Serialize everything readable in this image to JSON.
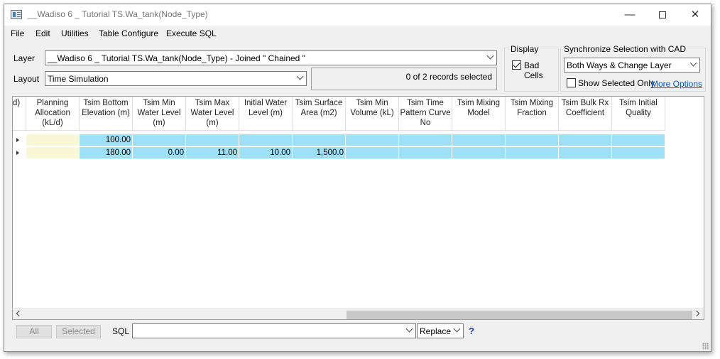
{
  "window": {
    "title": "__Wadiso 6 _ Tutorial TS.Wa_tank(Node_Type)"
  },
  "menu": [
    "File",
    "Edit",
    "Utilities",
    "Table Configure",
    "Execute SQL"
  ],
  "layer": {
    "label": "Layer",
    "value": "__Wadiso 6 _ Tutorial TS.Wa_tank(Node_Type) - Joined \" Chained \""
  },
  "layout": {
    "label": "Layout",
    "value": "Time Simulation"
  },
  "status": "0 of 2 records selected",
  "display": {
    "title": "Display",
    "bad_cells_label": "Bad Cells",
    "bad_cells_checked": true
  },
  "sync": {
    "title": "Synchronize Selection with CAD",
    "value": "Both Ways & Change Layer",
    "show_selected_label": "Show Selected Only",
    "show_selected_checked": false,
    "more_options": "More Options"
  },
  "table": {
    "partial_header": "d)",
    "columns": [
      "Planning Allocation (kL/d)",
      "Tsim Bottom Elevation (m)",
      "Tsim Min Water Level (m)",
      "Tsim Max Water Level (m)",
      "Initial Water Level (m)",
      "Tsim Surface Area (m2)",
      "Tsim Min Volume (kL)",
      "Tsim Time Pattern Curve No",
      "Tsim Mixing Model",
      "Tsim Mixing Fraction",
      "Tsim Bulk Rx Coefficient",
      "Tsim Initial Quality"
    ],
    "rows": [
      [
        "",
        "100.00",
        "",
        "",
        "",
        "",
        "",
        "",
        "",
        "",
        "",
        ""
      ],
      [
        "",
        "180.00",
        "0.00",
        "11.00",
        "10.00",
        "1,500.0",
        "",
        "",
        "",
        "",
        "",
        ""
      ]
    ]
  },
  "footer": {
    "all_label": "All",
    "selected_label": "Selected",
    "sql_label": "SQL",
    "sql_value": "",
    "replace_value": "Replace",
    "help_label": "?"
  }
}
